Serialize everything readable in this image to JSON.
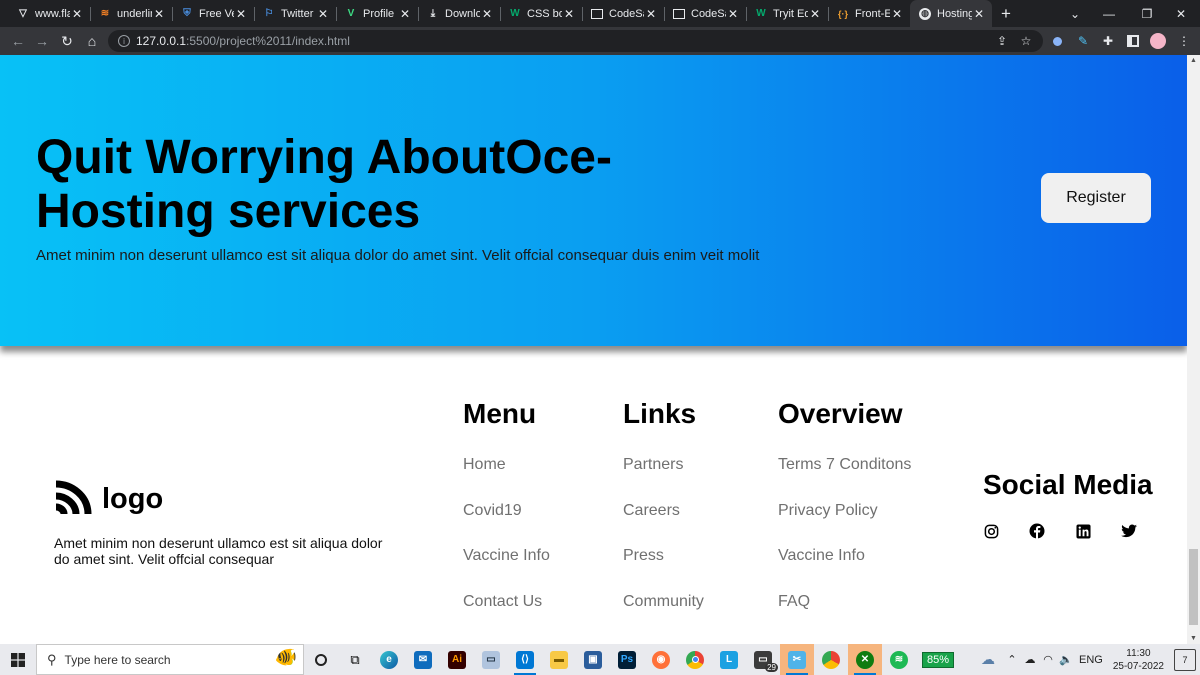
{
  "browser": {
    "tabs": [
      {
        "title": "www.fla",
        "icon": "vercel-icon",
        "active": false
      },
      {
        "title": "underlin",
        "icon": "stackoverflow-icon",
        "active": false
      },
      {
        "title": "Free Ve",
        "icon": "shield-icon",
        "active": false
      },
      {
        "title": "Twitter",
        "icon": "flag-icon",
        "active": false
      },
      {
        "title": "Profile",
        "icon": "v-icon",
        "active": false
      },
      {
        "title": "Downlo",
        "icon": "download-icon",
        "active": false
      },
      {
        "title": "CSS bo",
        "icon": "w-icon",
        "active": false
      },
      {
        "title": "CodeSa",
        "icon": "codesandbox-icon",
        "active": false
      },
      {
        "title": "CodeSa",
        "icon": "codesandbox-icon",
        "active": false
      },
      {
        "title": "Tryit Edi",
        "icon": "w-icon",
        "active": false
      },
      {
        "title": "Front-E",
        "icon": "brackets-icon",
        "active": false
      },
      {
        "title": "Hosting",
        "icon": "globe-icon",
        "active": true
      }
    ],
    "url_host": "127.0.0.1",
    "url_path": ":5500/project%2011/index.html"
  },
  "hero": {
    "title": "Quit Worrying AboutOce-Hosting services",
    "subtitle": "Amet minim non deserunt ullamco est sit aliqua dolor do amet sint. Velit offcial consequar duis enim veit molit",
    "register_label": "Register"
  },
  "footer": {
    "logo_text": "logo",
    "brand_desc": "Amet minim non deserunt ullamco est sit aliqua dolor do amet sint. Velit offcial consequar",
    "columns": [
      {
        "heading": "Menu",
        "links": [
          "Home",
          "Covid19",
          "Vaccine Info",
          "Contact Us"
        ]
      },
      {
        "heading": "Links",
        "links": [
          "Partners",
          "Careers",
          "Press",
          "Community"
        ]
      },
      {
        "heading": "Overview",
        "links": [
          "Terms 7 Conditons",
          "Privacy Policy",
          "Vaccine Info",
          "FAQ"
        ]
      }
    ],
    "social_heading": "Social Media",
    "social_icons": [
      "instagram-icon",
      "facebook-icon",
      "linkedin-icon",
      "twitter-icon"
    ]
  },
  "taskbar": {
    "search_placeholder": "Type here to search",
    "badge_count": "29",
    "battery": "85%",
    "language": "ENG",
    "time": "11:30",
    "date": "25-07-2022",
    "notification_count": "7"
  }
}
